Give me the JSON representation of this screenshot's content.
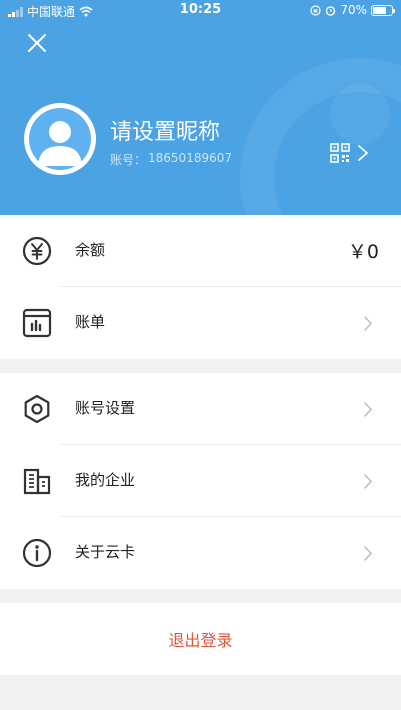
{
  "status_bar": {
    "carrier": "中国联通",
    "time": "10:25",
    "battery": "70%"
  },
  "profile": {
    "nickname": "请设置昵称",
    "account_label": "账号：",
    "account_number": "18650189607"
  },
  "section1": [
    {
      "label": "余额",
      "value": "￥0",
      "icon": "yuan-icon"
    },
    {
      "label": "账单",
      "icon": "bill-icon"
    }
  ],
  "section2": [
    {
      "label": "账号设置",
      "icon": "settings-hex-icon"
    },
    {
      "label": "我的企业",
      "icon": "building-icon"
    },
    {
      "label": "关于云卡",
      "icon": "info-icon"
    }
  ],
  "logout_label": "退出登录",
  "colors": {
    "header": "#4ba3e3",
    "logout": "#e0563b",
    "background": "#f2f2f5"
  }
}
